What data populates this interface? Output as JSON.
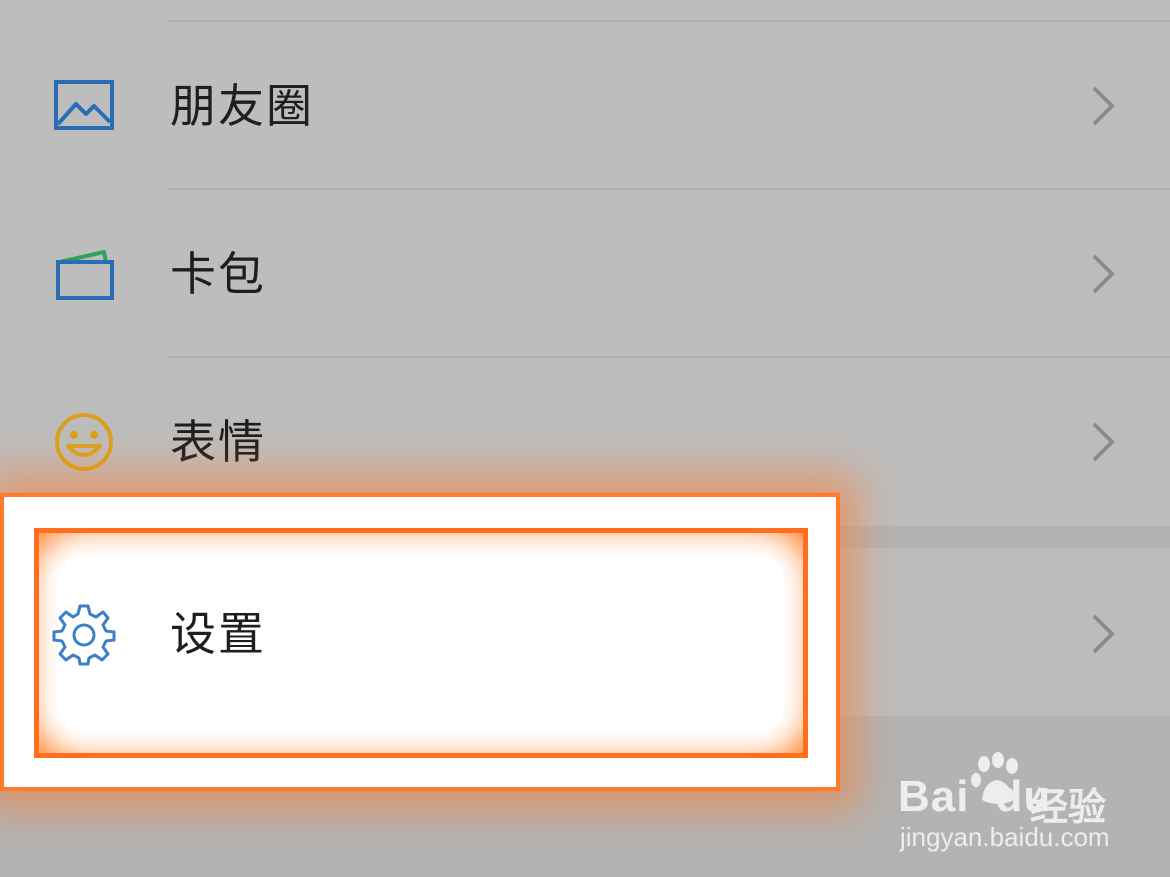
{
  "menu": {
    "items": [
      {
        "label": "朋友圈",
        "icon": "moments-picture-icon"
      },
      {
        "label": "卡包",
        "icon": "card-wallet-icon"
      },
      {
        "label": "表情",
        "icon": "smiley-face-icon"
      }
    ],
    "settings": {
      "label": "设置",
      "icon": "gear-icon"
    }
  },
  "highlight": {
    "color": "#ff7a2a"
  },
  "watermark": {
    "brand": "Bai",
    "brand_suffix": "du",
    "product": "经验",
    "url": "jingyan.baidu.com"
  },
  "colors": {
    "background": "#bdbdbd",
    "icon_blue": "#2a6db5",
    "icon_green": "#2fa35a",
    "icon_yellow": "#d9a21c",
    "chevron": "#8c8c8c"
  }
}
